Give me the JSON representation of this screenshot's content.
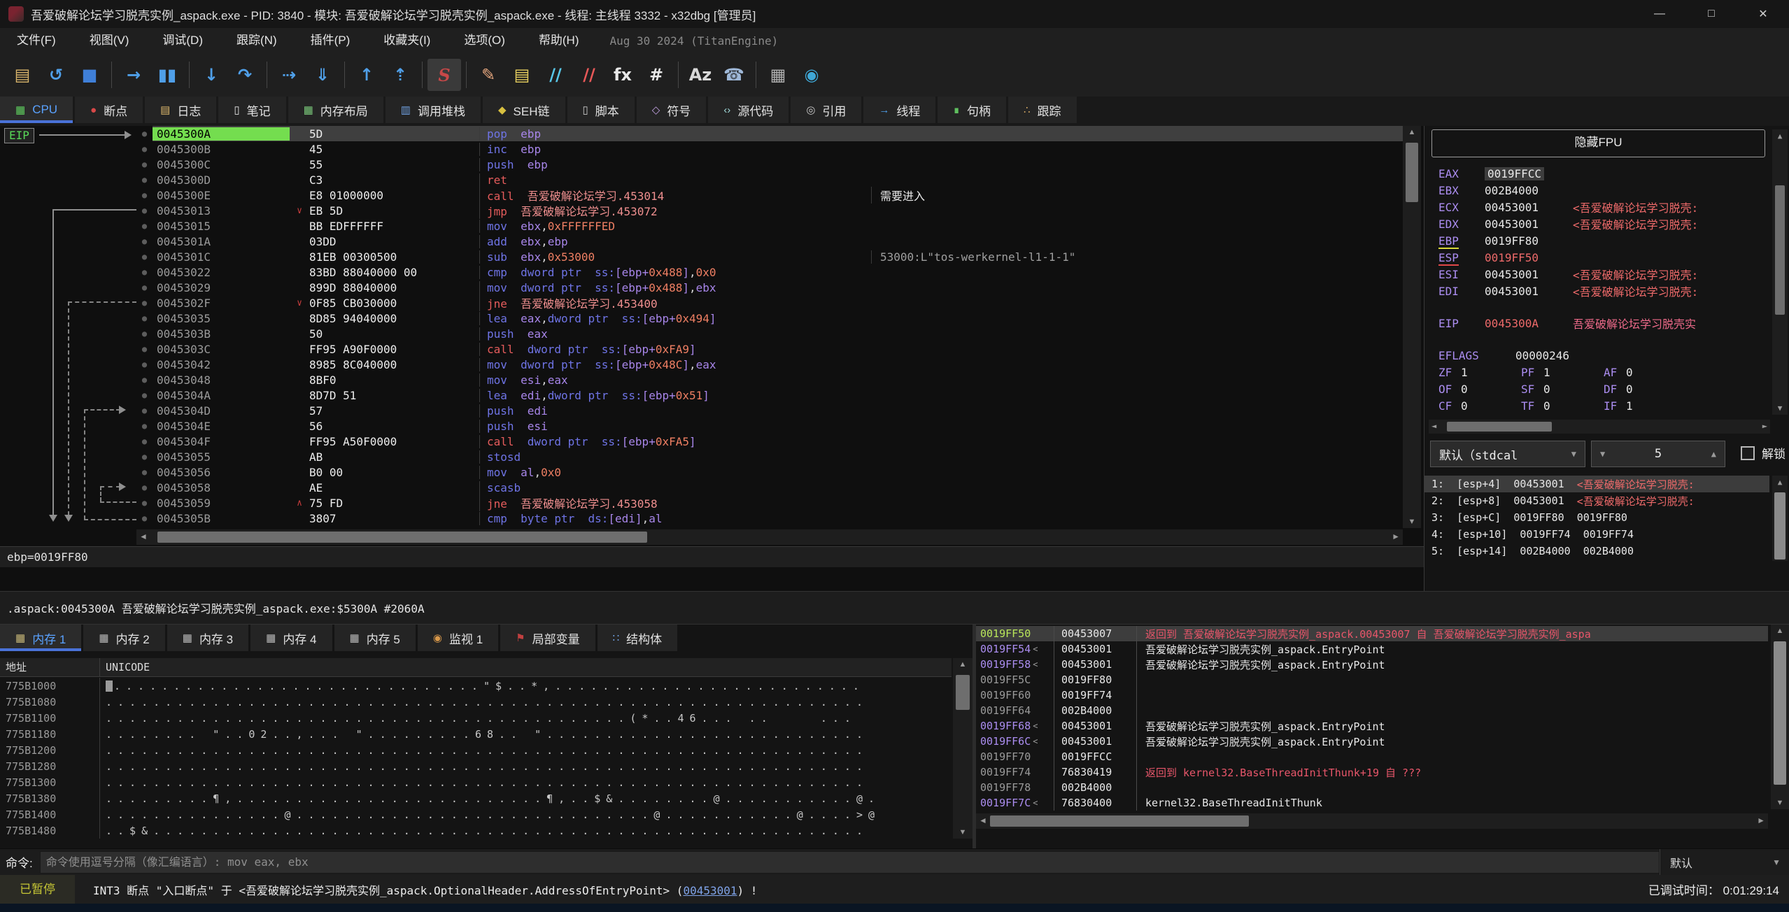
{
  "window": {
    "title": "吾爱破解论坛学习脱壳实例_aspack.exe - PID: 3840 - 模块: 吾爱破解论坛学习脱壳实例_aspack.exe - 线程: 主线程 3332 - x32dbg [管理员]",
    "controls": {
      "min": "—",
      "max": "□",
      "close": "✕"
    }
  },
  "menu": {
    "items": [
      "文件(F)",
      "视图(V)",
      "调试(D)",
      "跟踪(N)",
      "插件(P)",
      "收藏夹(I)",
      "选项(O)",
      "帮助(H)"
    ],
    "build": "Aug 30 2024 (TitanEngine)"
  },
  "toolbar": {
    "groups": [
      [
        {
          "name": "open-file-icon",
          "glyph": "▤",
          "color": "#d8b46a"
        },
        {
          "name": "restart-icon",
          "glyph": "↺",
          "color": "#4f9fe8"
        },
        {
          "name": "stop-icon",
          "glyph": "■",
          "color": "#3f7fd8"
        }
      ],
      [
        {
          "name": "run-icon",
          "glyph": "→",
          "color": "#4f9fe8"
        },
        {
          "name": "pause-icon",
          "glyph": "▮▮",
          "color": "#4f9fe8"
        }
      ],
      [
        {
          "name": "step-into-icon",
          "glyph": "↓",
          "color": "#4f9fe8"
        },
        {
          "name": "step-over-icon",
          "glyph": "↷",
          "color": "#4f9fe8"
        }
      ],
      [
        {
          "name": "run-to-user-code-icon",
          "glyph": "⇢",
          "color": "#4f9fe8"
        },
        {
          "name": "run-until-return-icon",
          "glyph": "⇓",
          "color": "#4f9fe8"
        }
      ],
      [
        {
          "name": "step-out-icon",
          "glyph": "↑",
          "color": "#4f9fe8"
        },
        {
          "name": "animate-into-icon",
          "glyph": "⇡",
          "color": "#4f9fe8"
        }
      ],
      [
        {
          "name": "assemble-icon",
          "glyph": "S",
          "color": "#c84848",
          "chip": true
        }
      ],
      [
        {
          "name": "patch-icon",
          "glyph": "✎",
          "color": "#e8a87f"
        },
        {
          "name": "comment-icon",
          "glyph": "▤",
          "color": "#e8d05f"
        },
        {
          "name": "label-icon",
          "glyph": "//",
          "color": "#58c7e8"
        },
        {
          "name": "bookmark-icon",
          "glyph": "//",
          "color": "#e85858"
        },
        {
          "name": "function-icon",
          "glyph": "fx",
          "color": "#e8e8e8"
        },
        {
          "name": "argument-icon",
          "glyph": "#",
          "color": "#e8e8e8"
        }
      ],
      [
        {
          "name": "strings-icon",
          "glyph": "Az",
          "color": "#d8d8d8"
        },
        {
          "name": "intermodular-calls-icon",
          "glyph": "☎",
          "color": "#9fb8d8"
        }
      ],
      [
        {
          "name": "calculator-icon",
          "glyph": "▦",
          "color": "#b0b0b0"
        },
        {
          "name": "internet-icon",
          "glyph": "◉",
          "color": "#3fa7d6"
        }
      ]
    ]
  },
  "tabs": [
    {
      "id": "cpu",
      "label": "CPU",
      "icon": "cpu-icon",
      "glyph": "▦",
      "color": "#5fcf5f",
      "active": true
    },
    {
      "id": "breakpoints",
      "label": "断点",
      "icon": "breakpoint-icon",
      "glyph": "●",
      "color": "#d84848"
    },
    {
      "id": "log",
      "label": "日志",
      "icon": "log-icon",
      "glyph": "▤",
      "color": "#d8b46a"
    },
    {
      "id": "notes",
      "label": "笔记",
      "icon": "notes-icon",
      "glyph": "▯",
      "color": "#e0e0e0"
    },
    {
      "id": "memory-map",
      "label": "内存布局",
      "icon": "memory-map-icon",
      "glyph": "▦",
      "color": "#79c779"
    },
    {
      "id": "call-stack",
      "label": "调用堆栈",
      "icon": "call-stack-icon",
      "glyph": "▥",
      "color": "#6f9fdf"
    },
    {
      "id": "seh",
      "label": "SEH链",
      "icon": "seh-chain-icon",
      "glyph": "◆",
      "color": "#d8c040"
    },
    {
      "id": "script",
      "label": "脚本",
      "icon": "script-icon",
      "glyph": "▯",
      "color": "#c8c8c8"
    },
    {
      "id": "symbols",
      "label": "符号",
      "icon": "symbols-icon",
      "glyph": "◇",
      "color": "#bf9fdf"
    },
    {
      "id": "source",
      "label": "源代码",
      "icon": "source-icon",
      "glyph": "‹›",
      "color": "#9fd8d8"
    },
    {
      "id": "references",
      "label": "引用",
      "icon": "references-icon",
      "glyph": "◎",
      "color": "#c8c8c8"
    },
    {
      "id": "threads",
      "label": "线程",
      "icon": "threads-icon",
      "glyph": "→",
      "color": "#4f9fe8"
    },
    {
      "id": "handles",
      "label": "句柄",
      "icon": "handles-icon",
      "glyph": "∎",
      "color": "#5fbf5f"
    },
    {
      "id": "trace",
      "label": "跟踪",
      "icon": "trace-icon",
      "glyph": "∴",
      "color": "#c8a060"
    }
  ],
  "disasm": {
    "eip_label": "EIP",
    "ebp_line": "ebp=0019FF80",
    "status_line": ".aspack:0045300A 吾爱破解论坛学习脱壳实例_aspack.exe:$5300A #2060A",
    "rows": [
      {
        "a": "0045300A",
        "b": "5D",
        "sel": true,
        "t": [
          [
            "mn",
            "pop  "
          ],
          [
            "reg",
            "ebp"
          ]
        ]
      },
      {
        "a": "0045300B",
        "b": "45",
        "t": [
          [
            "mn",
            "inc  "
          ],
          [
            "reg",
            "ebp"
          ]
        ]
      },
      {
        "a": "0045300C",
        "b": "55",
        "t": [
          [
            "mn",
            "push  "
          ],
          [
            "reg",
            "ebp"
          ]
        ]
      },
      {
        "a": "0045300D",
        "b": "C3",
        "t": [
          [
            "jmp",
            "ret "
          ]
        ]
      },
      {
        "a": "0045300E",
        "b": "E8 01000000",
        "t": [
          [
            "jmp",
            "call  "
          ],
          [
            "sym",
            "吾爱破解论坛学习.453014"
          ]
        ],
        "c": "需要进入",
        "cc": "cw"
      },
      {
        "a": "00453013",
        "b": "EB 5D",
        "m": "v",
        "t": [
          [
            "jmp",
            "jmp  "
          ],
          [
            "sym",
            "吾爱破解论坛学习.453072"
          ]
        ]
      },
      {
        "a": "00453015",
        "b": "BB EDFFFFFF",
        "t": [
          [
            "mn",
            "mov  "
          ],
          [
            "reg",
            "ebx"
          ],
          [
            "pl",
            ","
          ],
          [
            "num",
            "0xFFFFFFED"
          ]
        ]
      },
      {
        "a": "0045301A",
        "b": "03DD",
        "t": [
          [
            "mn",
            "add  "
          ],
          [
            "reg",
            "ebx"
          ],
          [
            "pl",
            ","
          ],
          [
            "reg",
            "ebp"
          ]
        ]
      },
      {
        "a": "0045301C",
        "b": "81EB 00300500",
        "t": [
          [
            "mn",
            "sub  "
          ],
          [
            "reg",
            "ebx"
          ],
          [
            "pl",
            ","
          ],
          [
            "num",
            "0x53000"
          ]
        ],
        "c": "53000:L\"tos-werkernel-l1-1-1\"",
        "cc": "cg"
      },
      {
        "a": "00453022",
        "b": "83BD 88040000 00",
        "t": [
          [
            "mn",
            "cmp  "
          ],
          [
            "kw",
            "dword ptr  ss:"
          ],
          [
            "reg",
            "[ebp+"
          ],
          [
            "num",
            "0x488"
          ],
          [
            "reg",
            "]"
          ],
          [
            "pl",
            ","
          ],
          [
            "num",
            "0x0"
          ]
        ]
      },
      {
        "a": "00453029",
        "b": "899D 88040000",
        "t": [
          [
            "mn",
            "mov  "
          ],
          [
            "kw",
            "dword ptr  ss:"
          ],
          [
            "reg",
            "[ebp+"
          ],
          [
            "num",
            "0x488"
          ],
          [
            "reg",
            "]"
          ],
          [
            "pl",
            ","
          ],
          [
            "reg",
            "ebx"
          ]
        ]
      },
      {
        "a": "0045302F",
        "b": "0F85 CB030000",
        "m": "v",
        "t": [
          [
            "jmp",
            "jne  "
          ],
          [
            "sym",
            "吾爱破解论坛学习.453400"
          ]
        ]
      },
      {
        "a": "00453035",
        "b": "8D85 94040000",
        "t": [
          [
            "mn",
            "lea  "
          ],
          [
            "reg",
            "eax"
          ],
          [
            "pl",
            ","
          ],
          [
            "kw",
            "dword ptr  ss:"
          ],
          [
            "reg",
            "[ebp+"
          ],
          [
            "num",
            "0x494"
          ],
          [
            "reg",
            "]"
          ]
        ]
      },
      {
        "a": "0045303B",
        "b": "50",
        "t": [
          [
            "mn",
            "push  "
          ],
          [
            "reg",
            "eax"
          ]
        ]
      },
      {
        "a": "0045303C",
        "b": "FF95 A90F0000",
        "t": [
          [
            "jmp",
            "call  "
          ],
          [
            "kw",
            "dword ptr  ss:"
          ],
          [
            "reg",
            "[ebp+"
          ],
          [
            "num",
            "0xFA9"
          ],
          [
            "reg",
            "]"
          ]
        ]
      },
      {
        "a": "00453042",
        "b": "8985 8C040000",
        "t": [
          [
            "mn",
            "mov  "
          ],
          [
            "kw",
            "dword ptr  ss:"
          ],
          [
            "reg",
            "[ebp+"
          ],
          [
            "num",
            "0x48C"
          ],
          [
            "reg",
            "]"
          ],
          [
            "pl",
            ","
          ],
          [
            "reg",
            "eax"
          ]
        ]
      },
      {
        "a": "00453048",
        "b": "8BF0",
        "t": [
          [
            "mn",
            "mov  "
          ],
          [
            "reg",
            "esi"
          ],
          [
            "pl",
            ","
          ],
          [
            "reg",
            "eax"
          ]
        ]
      },
      {
        "a": "0045304A",
        "b": "8D7D 51",
        "t": [
          [
            "mn",
            "lea  "
          ],
          [
            "reg",
            "edi"
          ],
          [
            "pl",
            ","
          ],
          [
            "kw",
            "dword ptr  ss:"
          ],
          [
            "reg",
            "[ebp+"
          ],
          [
            "num",
            "0x51"
          ],
          [
            "reg",
            "]"
          ]
        ]
      },
      {
        "a": "0045304D",
        "b": "57",
        "t": [
          [
            "mn",
            "push  "
          ],
          [
            "reg",
            "edi"
          ]
        ]
      },
      {
        "a": "0045304E",
        "b": "56",
        "t": [
          [
            "mn",
            "push  "
          ],
          [
            "reg",
            "esi"
          ]
        ]
      },
      {
        "a": "0045304F",
        "b": "FF95 A50F0000",
        "t": [
          [
            "jmp",
            "call  "
          ],
          [
            "kw",
            "dword ptr  ss:"
          ],
          [
            "reg",
            "[ebp+"
          ],
          [
            "num",
            "0xFA5"
          ],
          [
            "reg",
            "]"
          ]
        ]
      },
      {
        "a": "00453055",
        "b": "AB",
        "t": [
          [
            "mn",
            "stosd "
          ]
        ]
      },
      {
        "a": "00453056",
        "b": "B0 00",
        "t": [
          [
            "mn",
            "mov  "
          ],
          [
            "reg",
            "al"
          ],
          [
            "pl",
            ","
          ],
          [
            "num",
            "0x0"
          ]
        ]
      },
      {
        "a": "00453058",
        "b": "AE",
        "t": [
          [
            "mn",
            "scasb "
          ]
        ]
      },
      {
        "a": "00453059",
        "b": "75 FD",
        "m": "^",
        "t": [
          [
            "jmp",
            "jne  "
          ],
          [
            "sym",
            "吾爱破解论坛学习.453058"
          ]
        ]
      },
      {
        "a": "0045305B",
        "b": "3807",
        "t": [
          [
            "mn",
            "cmp  "
          ],
          [
            "kw",
            "byte ptr  ds:"
          ],
          [
            "reg",
            "[edi]"
          ],
          [
            "pl",
            ","
          ],
          [
            "reg",
            "al"
          ]
        ]
      }
    ]
  },
  "registers": {
    "fpu_button": "隐藏FPU",
    "regs": [
      {
        "n": "EAX",
        "v": "0019FFCC",
        "vsel": true
      },
      {
        "n": "EBX",
        "v": "002B4000"
      },
      {
        "n": "ECX",
        "v": "00453001",
        "c": "<吾爱破解论坛学习脱壳:"
      },
      {
        "n": "EDX",
        "v": "00453001",
        "c": "<吾爱破解论坛学习脱壳:"
      },
      {
        "n": "EBP",
        "v": "0019FF80",
        "u": "y"
      },
      {
        "n": "ESP",
        "v": "0019FF50",
        "u": "r",
        "vcls": "red"
      },
      {
        "n": "ESI",
        "v": "00453001",
        "c": "<吾爱破解论坛学习脱壳:"
      },
      {
        "n": "EDI",
        "v": "00453001",
        "c": "<吾爱破解论坛学习脱壳:"
      },
      {
        "n": "EIP",
        "v": "0045300A",
        "vcls": "red",
        "c": "吾爱破解论坛学习脱壳实",
        "ccls": "pink",
        "gap": true
      }
    ],
    "eflags": {
      "label": "EFLAGS",
      "value": "00000246"
    },
    "flags": [
      [
        "ZF",
        "1",
        "PF",
        "1",
        "AF",
        "0"
      ],
      [
        "OF",
        "0",
        "SF",
        "0",
        "DF",
        "0"
      ],
      [
        "CF",
        "0",
        "TF",
        "0",
        "IF",
        "1"
      ]
    ],
    "conv": {
      "selected": "默认（stdcal",
      "depth": "5",
      "unlock_label": "解锁"
    },
    "args": [
      {
        "pre": "1:  [esp+4]  00453001  ",
        "sym": "<吾爱破解论坛学习脱壳:",
        "sel": true
      },
      {
        "pre": "2:  [esp+8]  00453001  ",
        "sym": "<吾爱破解论坛学习脱壳:"
      },
      {
        "pre": "3:  [esp+C]  0019FF80  0019FF80"
      },
      {
        "pre": "4:  [esp+10]  0019FF74  0019FF74"
      },
      {
        "pre": "5:  [esp+14]  002B4000  002B4000"
      }
    ]
  },
  "dump": {
    "tabs": [
      {
        "id": "mem1",
        "label": "内存 1",
        "icon": "memory-icon",
        "glyph": "▦",
        "color": "#c8b878",
        "active": true
      },
      {
        "id": "mem2",
        "label": "内存 2",
        "icon": "memory-icon",
        "glyph": "▦",
        "color": "#b8b8b8"
      },
      {
        "id": "mem3",
        "label": "内存 3",
        "icon": "memory-icon",
        "glyph": "▦",
        "color": "#b8b8b8"
      },
      {
        "id": "mem4",
        "label": "内存 4",
        "icon": "memory-icon",
        "glyph": "▦",
        "color": "#b8b8b8"
      },
      {
        "id": "mem5",
        "label": "内存 5",
        "icon": "memory-icon",
        "glyph": "▦",
        "color": "#b8b8b8"
      },
      {
        "id": "watch1",
        "label": "监视 1",
        "icon": "watch-icon",
        "glyph": "◉",
        "color": "#d9984a"
      },
      {
        "id": "locals",
        "label": "局部变量",
        "icon": "locals-icon",
        "glyph": "⚑",
        "color": "#c04040"
      },
      {
        "id": "struct",
        "label": "结构体",
        "icon": "struct-icon",
        "glyph": "∷",
        "color": "#6f9fdf"
      }
    ],
    "col_addr": "地址",
    "col_unicode": "UNICODE",
    "rows": [
      {
        "a": "775B1000",
        "cur": true,
        "t": "...............................\"$..*,.........................."
      },
      {
        "a": "775B1080",
        "t": "................................................................"
      },
      {
        "a": "775B1100",
        "t": "............................................(*..46... ..    ..."
      },
      {
        "a": "775B1180",
        "t": "........ \"..02..,... \".........68.. \"..........................."
      },
      {
        "a": "775B1200",
        "t": "................................................................"
      },
      {
        "a": "775B1280",
        "t": "................................................................"
      },
      {
        "a": "775B1300",
        "t": "................................................................"
      },
      {
        "a": "775B1380",
        "t": ".........¶,..........................¶,..$&........@...........@."
      },
      {
        "a": "775B1400",
        "t": "...............@..............................@...........@....>@"
      },
      {
        "a": "775B1480",
        "t": "..$&............................................................"
      }
    ]
  },
  "stack": {
    "rows": [
      {
        "a": "0019FF50",
        "ac": "lime",
        "v": "00453007",
        "c": "返回到 吾爱破解论坛学习脱壳实例_aspack.00453007 自 吾爱破解论坛学习脱壳实例_aspa",
        "cc": "red",
        "sel": true
      },
      {
        "a": "0019FF54",
        "ac": "pur",
        "lt": true,
        "v": "00453001",
        "c": "吾爱破解论坛学习脱壳实例_aspack.EntryPoint",
        "cc": "wh"
      },
      {
        "a": "0019FF58",
        "ac": "pur",
        "lt": true,
        "v": "00453001",
        "c": "吾爱破解论坛学习脱壳实例_aspack.EntryPoint",
        "cc": "wh"
      },
      {
        "a": "0019FF5C",
        "ac": "dim",
        "v": "0019FF80"
      },
      {
        "a": "0019FF60",
        "ac": "dim",
        "v": "0019FF74"
      },
      {
        "a": "0019FF64",
        "ac": "dim",
        "v": "002B4000"
      },
      {
        "a": "0019FF68",
        "ac": "pur",
        "lt": true,
        "v": "00453001",
        "c": "吾爱破解论坛学习脱壳实例_aspack.EntryPoint",
        "cc": "wh"
      },
      {
        "a": "0019FF6C",
        "ac": "pur",
        "lt": true,
        "v": "00453001",
        "c": "吾爱破解论坛学习脱壳实例_aspack.EntryPoint",
        "cc": "wh"
      },
      {
        "a": "0019FF70",
        "ac": "dim",
        "v": "0019FFCC"
      },
      {
        "a": "0019FF74",
        "ac": "dim",
        "v": "76830419",
        "c": "返回到 kernel32.BaseThreadInitThunk+19 自 ???",
        "cc": "red"
      },
      {
        "a": "0019FF78",
        "ac": "dim",
        "v": "002B4000"
      },
      {
        "a": "0019FF7C",
        "ac": "pur",
        "lt": true,
        "v": "76830400",
        "c": "kernel32.BaseThreadInitThunk",
        "cc": "wh"
      }
    ]
  },
  "command": {
    "label": "命令:",
    "placeholder": "命令使用逗号分隔（像汇编语言）: mov eax, ebx",
    "combo": "默认"
  },
  "status": {
    "state": "已暂停",
    "msg_pre": "INT3 断点 \"入口断点\" 于 <吾爱破解论坛学习脱壳实例_aspack.OptionalHeader.AddressOfEntryPoint> (",
    "link": "00453001",
    "msg_post": ") !",
    "time_label": "已调试时间：",
    "time": "0:01:29:14"
  }
}
